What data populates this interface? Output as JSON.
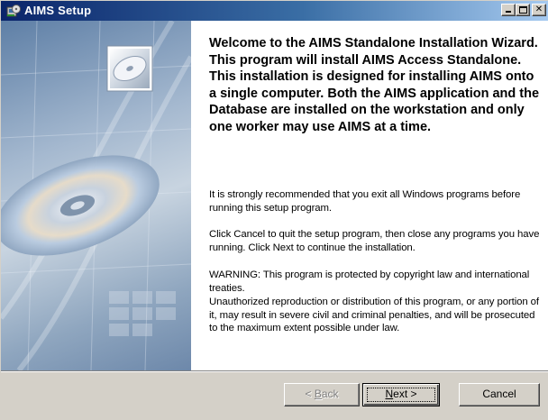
{
  "window": {
    "title": "AIMS Setup",
    "controls": {
      "minimize": "minimize-icon",
      "maximize": "maximize-icon",
      "close": "close-icon"
    }
  },
  "banner": {
    "image": "cd-disc-artwork"
  },
  "content": {
    "heading": "Welcome to the AIMS Standalone Installation Wizard. This program will install AIMS Access Standalone. This installation is designed for installing AIMS onto a single computer. Both the AIMS application and the Database are installed on the workstation and only one worker may use AIMS at a time.",
    "paragraphs": [
      "It is strongly recommended that you exit all Windows programs before running this setup program.",
      "Click Cancel to quit the setup program, then close any programs you have running.  Click Next to continue the installation.",
      "WARNING: This program is protected by copyright law and international treaties.",
      "Unauthorized reproduction or distribution of this program, or any portion of it, may result in severe civil and criminal penalties, and will be prosecuted to the maximum extent possible under law."
    ]
  },
  "buttons": {
    "back_prefix": "< ",
    "back_hotkey": "B",
    "back_rest": "ack",
    "next_hotkey": "N",
    "next_rest": "ext >",
    "cancel": "Cancel"
  },
  "colors": {
    "titlebar_start": "#0a246a",
    "titlebar_end": "#a6caf0",
    "face": "#d4d0c8"
  }
}
